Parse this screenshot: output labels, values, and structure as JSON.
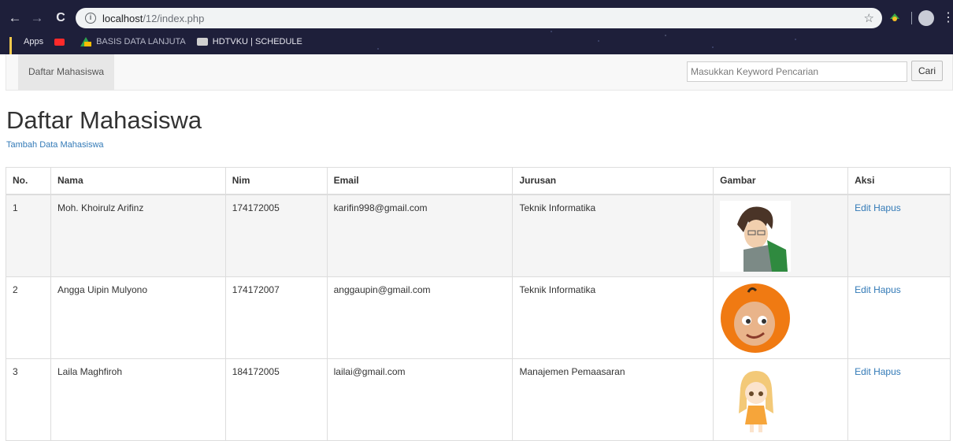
{
  "browser": {
    "url_host": "localhost",
    "url_path": "/12/index.php",
    "bookmarks": [
      {
        "label": "Apps",
        "icon": "apps-icon"
      },
      {
        "label": "",
        "icon": "youtube-icon"
      },
      {
        "label": "BASIS DATA LANJUTA",
        "icon": "google-drive-icon"
      },
      {
        "label": "HDTVKU | SCHEDULE",
        "icon": "hdtvku-icon"
      }
    ]
  },
  "navbar": {
    "active_item": "Daftar Mahasiswa",
    "search_placeholder": "Masukkan Keyword Pencarian",
    "search_button": "Cari"
  },
  "page": {
    "title": "Daftar Mahasiswa",
    "add_link": "Tambah Data Mahasiswa"
  },
  "table": {
    "headers": [
      "No.",
      "Nama",
      "Nim",
      "Email",
      "Jurusan",
      "Gambar",
      "Aksi"
    ],
    "rows": [
      {
        "no": "1",
        "nama": "Moh. Khoirulz Arifinz",
        "nim": "174172005",
        "email": "karifin998@gmail.com",
        "jurusan": "Teknik Informatika",
        "edit": "Edit",
        "hapus": "Hapus"
      },
      {
        "no": "2",
        "nama": "Angga Uipin Mulyono",
        "nim": "174172007",
        "email": "anggaupin@gmail.com",
        "jurusan": "Teknik Informatika",
        "edit": "Edit",
        "hapus": "Hapus"
      },
      {
        "no": "3",
        "nama": "Laila Maghfiroh",
        "nim": "184172005",
        "email": "lailai@gmail.com",
        "jurusan": "Manajemen Pemaasaran",
        "edit": "Edit",
        "hapus": "Hapus"
      }
    ]
  }
}
